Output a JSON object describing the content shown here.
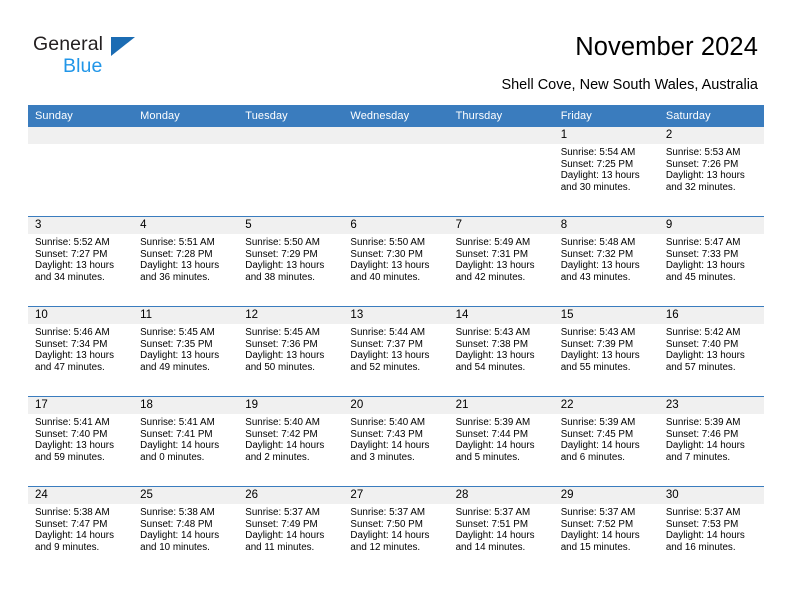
{
  "brand": {
    "name_top": "General",
    "name_bottom": "Blue",
    "triangle_color": "#1b6cb3",
    "blue_text_color": "#2196e8"
  },
  "header": {
    "title": "November 2024",
    "subtitle": "Shell Cove, New South Wales, Australia"
  },
  "theme": {
    "header_bg": "#3a7cbe",
    "header_text": "#ffffff",
    "date_band_bg": "#f0f0f0",
    "row_divider": "#3a7cbe",
    "page_bg": "#ffffff",
    "body_text": "#000000"
  },
  "columns": [
    "Sunday",
    "Monday",
    "Tuesday",
    "Wednesday",
    "Thursday",
    "Friday",
    "Saturday"
  ],
  "labels": {
    "sunrise_prefix": "Sunrise:",
    "sunset_prefix": "Sunset:",
    "daylight_prefix": "Daylight:"
  },
  "weeks": [
    [
      {
        "empty": true
      },
      {
        "empty": true
      },
      {
        "empty": true
      },
      {
        "empty": true
      },
      {
        "empty": true
      },
      {
        "date": "1",
        "sunrise": "Sunrise: 5:54 AM",
        "sunset": "Sunset: 7:25 PM",
        "daylight_line1": "Daylight: 13 hours",
        "daylight_line2": "and 30 minutes."
      },
      {
        "date": "2",
        "sunrise": "Sunrise: 5:53 AM",
        "sunset": "Sunset: 7:26 PM",
        "daylight_line1": "Daylight: 13 hours",
        "daylight_line2": "and 32 minutes."
      }
    ],
    [
      {
        "date": "3",
        "sunrise": "Sunrise: 5:52 AM",
        "sunset": "Sunset: 7:27 PM",
        "daylight_line1": "Daylight: 13 hours",
        "daylight_line2": "and 34 minutes."
      },
      {
        "date": "4",
        "sunrise": "Sunrise: 5:51 AM",
        "sunset": "Sunset: 7:28 PM",
        "daylight_line1": "Daylight: 13 hours",
        "daylight_line2": "and 36 minutes."
      },
      {
        "date": "5",
        "sunrise": "Sunrise: 5:50 AM",
        "sunset": "Sunset: 7:29 PM",
        "daylight_line1": "Daylight: 13 hours",
        "daylight_line2": "and 38 minutes."
      },
      {
        "date": "6",
        "sunrise": "Sunrise: 5:50 AM",
        "sunset": "Sunset: 7:30 PM",
        "daylight_line1": "Daylight: 13 hours",
        "daylight_line2": "and 40 minutes."
      },
      {
        "date": "7",
        "sunrise": "Sunrise: 5:49 AM",
        "sunset": "Sunset: 7:31 PM",
        "daylight_line1": "Daylight: 13 hours",
        "daylight_line2": "and 42 minutes."
      },
      {
        "date": "8",
        "sunrise": "Sunrise: 5:48 AM",
        "sunset": "Sunset: 7:32 PM",
        "daylight_line1": "Daylight: 13 hours",
        "daylight_line2": "and 43 minutes."
      },
      {
        "date": "9",
        "sunrise": "Sunrise: 5:47 AM",
        "sunset": "Sunset: 7:33 PM",
        "daylight_line1": "Daylight: 13 hours",
        "daylight_line2": "and 45 minutes."
      }
    ],
    [
      {
        "date": "10",
        "sunrise": "Sunrise: 5:46 AM",
        "sunset": "Sunset: 7:34 PM",
        "daylight_line1": "Daylight: 13 hours",
        "daylight_line2": "and 47 minutes."
      },
      {
        "date": "11",
        "sunrise": "Sunrise: 5:45 AM",
        "sunset": "Sunset: 7:35 PM",
        "daylight_line1": "Daylight: 13 hours",
        "daylight_line2": "and 49 minutes."
      },
      {
        "date": "12",
        "sunrise": "Sunrise: 5:45 AM",
        "sunset": "Sunset: 7:36 PM",
        "daylight_line1": "Daylight: 13 hours",
        "daylight_line2": "and 50 minutes."
      },
      {
        "date": "13",
        "sunrise": "Sunrise: 5:44 AM",
        "sunset": "Sunset: 7:37 PM",
        "daylight_line1": "Daylight: 13 hours",
        "daylight_line2": "and 52 minutes."
      },
      {
        "date": "14",
        "sunrise": "Sunrise: 5:43 AM",
        "sunset": "Sunset: 7:38 PM",
        "daylight_line1": "Daylight: 13 hours",
        "daylight_line2": "and 54 minutes."
      },
      {
        "date": "15",
        "sunrise": "Sunrise: 5:43 AM",
        "sunset": "Sunset: 7:39 PM",
        "daylight_line1": "Daylight: 13 hours",
        "daylight_line2": "and 55 minutes."
      },
      {
        "date": "16",
        "sunrise": "Sunrise: 5:42 AM",
        "sunset": "Sunset: 7:40 PM",
        "daylight_line1": "Daylight: 13 hours",
        "daylight_line2": "and 57 minutes."
      }
    ],
    [
      {
        "date": "17",
        "sunrise": "Sunrise: 5:41 AM",
        "sunset": "Sunset: 7:40 PM",
        "daylight_line1": "Daylight: 13 hours",
        "daylight_line2": "and 59 minutes."
      },
      {
        "date": "18",
        "sunrise": "Sunrise: 5:41 AM",
        "sunset": "Sunset: 7:41 PM",
        "daylight_line1": "Daylight: 14 hours",
        "daylight_line2": "and 0 minutes."
      },
      {
        "date": "19",
        "sunrise": "Sunrise: 5:40 AM",
        "sunset": "Sunset: 7:42 PM",
        "daylight_line1": "Daylight: 14 hours",
        "daylight_line2": "and 2 minutes."
      },
      {
        "date": "20",
        "sunrise": "Sunrise: 5:40 AM",
        "sunset": "Sunset: 7:43 PM",
        "daylight_line1": "Daylight: 14 hours",
        "daylight_line2": "and 3 minutes."
      },
      {
        "date": "21",
        "sunrise": "Sunrise: 5:39 AM",
        "sunset": "Sunset: 7:44 PM",
        "daylight_line1": "Daylight: 14 hours",
        "daylight_line2": "and 5 minutes."
      },
      {
        "date": "22",
        "sunrise": "Sunrise: 5:39 AM",
        "sunset": "Sunset: 7:45 PM",
        "daylight_line1": "Daylight: 14 hours",
        "daylight_line2": "and 6 minutes."
      },
      {
        "date": "23",
        "sunrise": "Sunrise: 5:39 AM",
        "sunset": "Sunset: 7:46 PM",
        "daylight_line1": "Daylight: 14 hours",
        "daylight_line2": "and 7 minutes."
      }
    ],
    [
      {
        "date": "24",
        "sunrise": "Sunrise: 5:38 AM",
        "sunset": "Sunset: 7:47 PM",
        "daylight_line1": "Daylight: 14 hours",
        "daylight_line2": "and 9 minutes."
      },
      {
        "date": "25",
        "sunrise": "Sunrise: 5:38 AM",
        "sunset": "Sunset: 7:48 PM",
        "daylight_line1": "Daylight: 14 hours",
        "daylight_line2": "and 10 minutes."
      },
      {
        "date": "26",
        "sunrise": "Sunrise: 5:37 AM",
        "sunset": "Sunset: 7:49 PM",
        "daylight_line1": "Daylight: 14 hours",
        "daylight_line2": "and 11 minutes."
      },
      {
        "date": "27",
        "sunrise": "Sunrise: 5:37 AM",
        "sunset": "Sunset: 7:50 PM",
        "daylight_line1": "Daylight: 14 hours",
        "daylight_line2": "and 12 minutes."
      },
      {
        "date": "28",
        "sunrise": "Sunrise: 5:37 AM",
        "sunset": "Sunset: 7:51 PM",
        "daylight_line1": "Daylight: 14 hours",
        "daylight_line2": "and 14 minutes."
      },
      {
        "date": "29",
        "sunrise": "Sunrise: 5:37 AM",
        "sunset": "Sunset: 7:52 PM",
        "daylight_line1": "Daylight: 14 hours",
        "daylight_line2": "and 15 minutes."
      },
      {
        "date": "30",
        "sunrise": "Sunrise: 5:37 AM",
        "sunset": "Sunset: 7:53 PM",
        "daylight_line1": "Daylight: 14 hours",
        "daylight_line2": "and 16 minutes."
      }
    ]
  ]
}
